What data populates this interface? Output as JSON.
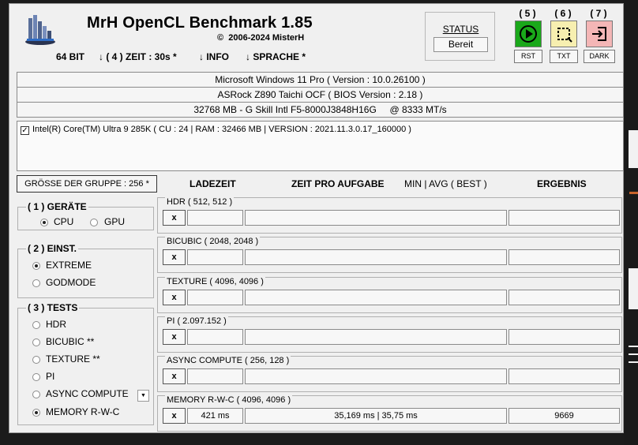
{
  "app": {
    "title": "MrH OpenCL Benchmark 1.85",
    "copyright_symbol": "©",
    "copyright": "2006-2024 MisterH"
  },
  "menu": {
    "bits": "64 BIT",
    "time": "↓ ( 4 ) ZEIT : 30s *",
    "info": "↓ INFO",
    "language": "↓ SPRACHE *"
  },
  "status": {
    "label": "STATUS",
    "value": "Bereit"
  },
  "hotkeys": [
    {
      "number": "( 5 )",
      "label": "RST",
      "icon": "play-icon",
      "color": "#1aa81a"
    },
    {
      "number": "( 6 )",
      "label": "TXT",
      "icon": "selection-icon",
      "color": "#f7efb0"
    },
    {
      "number": "( 7 )",
      "label": "DARK",
      "icon": "login-icon",
      "color": "#f4b6b6"
    }
  ],
  "system": {
    "os": "Microsoft Windows 11 Pro ( Version : 10.0.26100 )",
    "board": "ASRock Z890 Taichi OCF ( BIOS Version : 2.18 )",
    "memory": "32768 MB - G Skill Intl F5-8000J3848H16G     @ 8333 MT/s"
  },
  "device": {
    "checked": true,
    "label": "Intel(R) Core(TM) Ultra 9 285K ( CU : 24 | RAM : 32466 MB | VERSION : 2021.11.3.0.17_160000 )"
  },
  "group_size": "GRÖSSE DER GRUPPE : 256 *",
  "columns": {
    "load": "LADEZEIT",
    "time_per_task": "ZEIT PRO AUFGABE",
    "minavg": "MIN | AVG ( BEST )",
    "result": "ERGEBNIS"
  },
  "devices_panel": {
    "title": "( 1 ) GERÄTE",
    "options": [
      {
        "label": "CPU",
        "selected": true
      },
      {
        "label": "GPU",
        "selected": false
      }
    ]
  },
  "settings_panel": {
    "title": "( 2 ) EINST.",
    "options": [
      {
        "label": "EXTREME",
        "selected": true
      },
      {
        "label": "GODMODE",
        "selected": false
      }
    ]
  },
  "tests_panel": {
    "title": "( 3 ) TESTS",
    "options": [
      {
        "label": "HDR",
        "selected": false
      },
      {
        "label": "BICUBIC **",
        "selected": false
      },
      {
        "label": "TEXTURE **",
        "selected": false
      },
      {
        "label": "PI",
        "selected": false
      },
      {
        "label": "ASYNC COMPUTE",
        "selected": false
      },
      {
        "label": "MEMORY R-W-C",
        "selected": true
      }
    ]
  },
  "tests": [
    {
      "name": "HDR ( 512, 512 )",
      "x": "x",
      "load": "",
      "time": "",
      "result": ""
    },
    {
      "name": "BICUBIC ( 2048, 2048 )",
      "x": "x",
      "load": "",
      "time": "",
      "result": ""
    },
    {
      "name": "TEXTURE ( 4096, 4096 )",
      "x": "x",
      "load": "",
      "time": "",
      "result": ""
    },
    {
      "name": "PI ( 2.097.152 )",
      "x": "x",
      "load": "",
      "time": "",
      "result": ""
    },
    {
      "name": "ASYNC COMPUTE ( 256, 128 )",
      "x": "x",
      "load": "",
      "time": "",
      "result": ""
    },
    {
      "name": "MEMORY R-W-C ( 4096, 4096 )",
      "x": "x",
      "load": "421 ms",
      "time": "35,169 ms | 35,75 ms",
      "result": "9669"
    }
  ]
}
